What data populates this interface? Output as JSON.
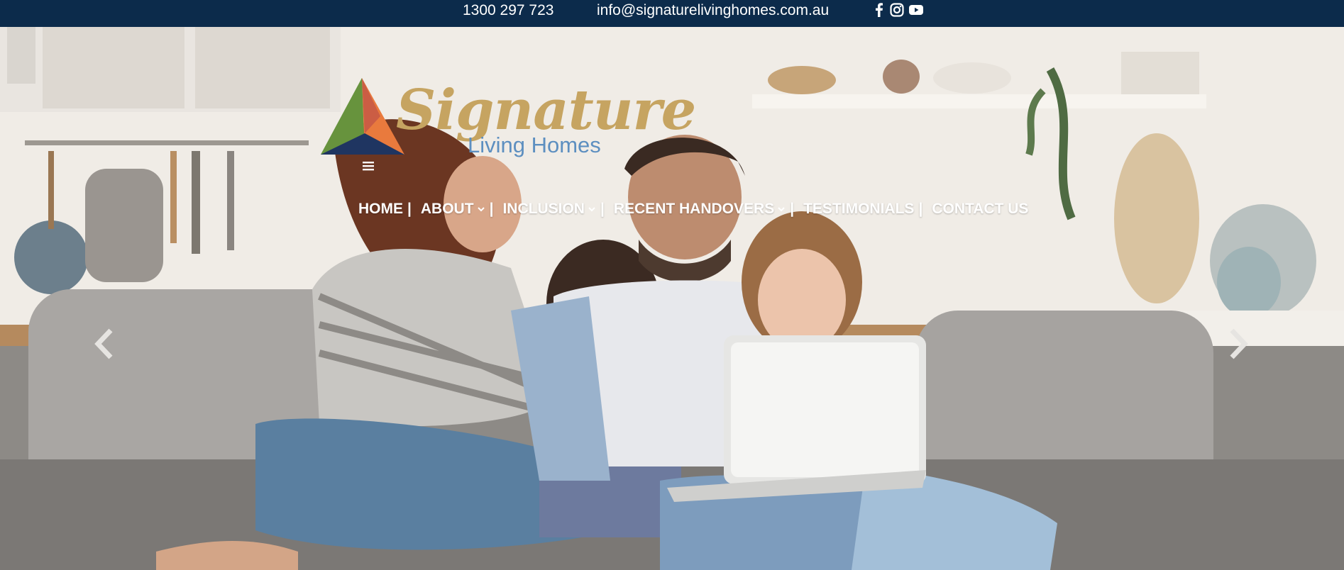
{
  "topbar": {
    "phone": "1300 297 723",
    "email": "info@signaturelivinghomes.com.au",
    "social_icons": [
      "facebook-icon",
      "instagram-icon",
      "youtube-icon"
    ],
    "background_color": "#0c2b4b"
  },
  "logo": {
    "title": "Signature",
    "subtitle": "Living Homes",
    "title_color": "#c6a461",
    "subtitle_color": "#5d8fc0"
  },
  "nav": {
    "menu_icon": "hamburger-menu-icon",
    "items": [
      {
        "label": "HOME",
        "separator": "|",
        "dropdown": false
      },
      {
        "label": "ABOUT",
        "separator": "|",
        "dropdown": true
      },
      {
        "label": "INCLUSION",
        "separator": "|",
        "dropdown": true
      },
      {
        "label": "RECENT HANDOVERS",
        "separator": "|",
        "dropdown": true
      },
      {
        "label": "TESTIMONIALS",
        "separator": "|",
        "dropdown": false
      },
      {
        "label": "CONTACT US",
        "separator": "",
        "dropdown": false
      }
    ]
  },
  "slider": {
    "prev_icon": "chevron-left-icon",
    "next_icon": "chevron-right-icon"
  }
}
